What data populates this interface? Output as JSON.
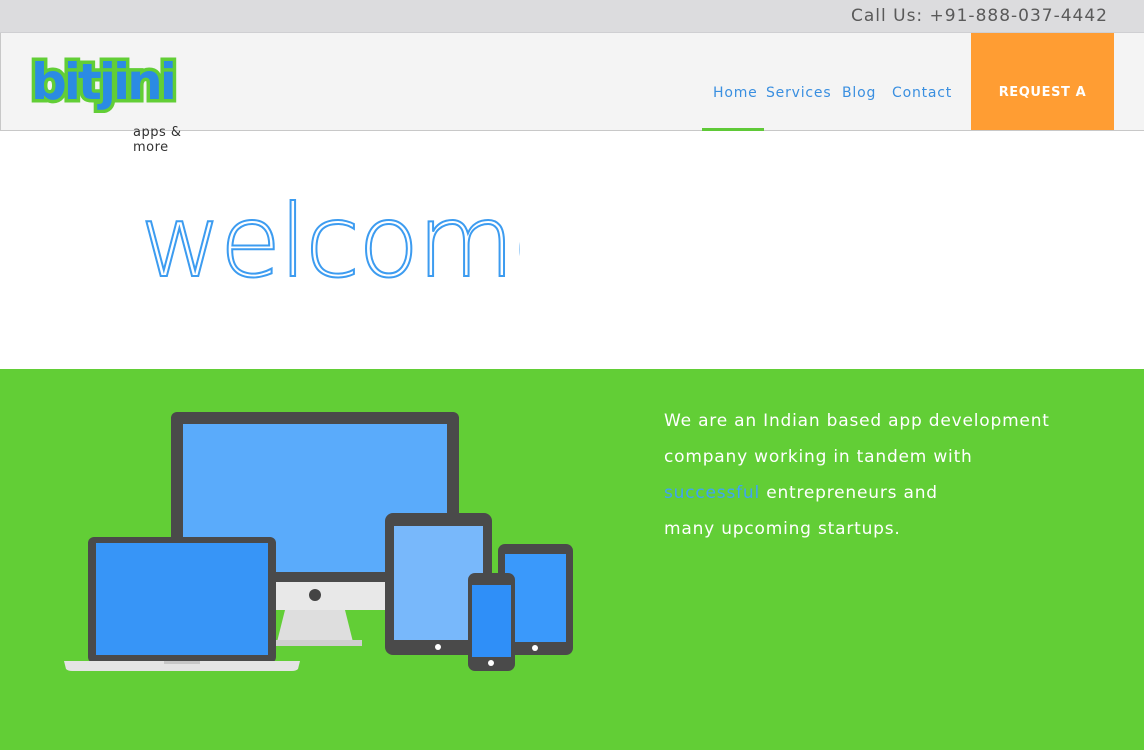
{
  "topbar": {
    "phone": "Call Us: +91-888-037-4442"
  },
  "logo": {
    "word": "bitjini",
    "tagline": "apps & more"
  },
  "nav": {
    "items": [
      {
        "label": "Home"
      },
      {
        "label": "Services"
      },
      {
        "label": "Blog"
      },
      {
        "label": "Contact"
      }
    ],
    "active": "Home",
    "quote_button": "REQUEST A QUOTE"
  },
  "hero": {
    "title": "welcome"
  },
  "intro": {
    "line1": "We are an Indian based app development",
    "line2": "company working in tandem with",
    "highlight": "successful",
    "line3_rest": " entrepreneurs and",
    "line4": "many upcoming startups."
  },
  "colors": {
    "accent_blue": "#3d9cf0",
    "brand_green": "#62ce36",
    "quote_orange": "#ff9d33"
  }
}
